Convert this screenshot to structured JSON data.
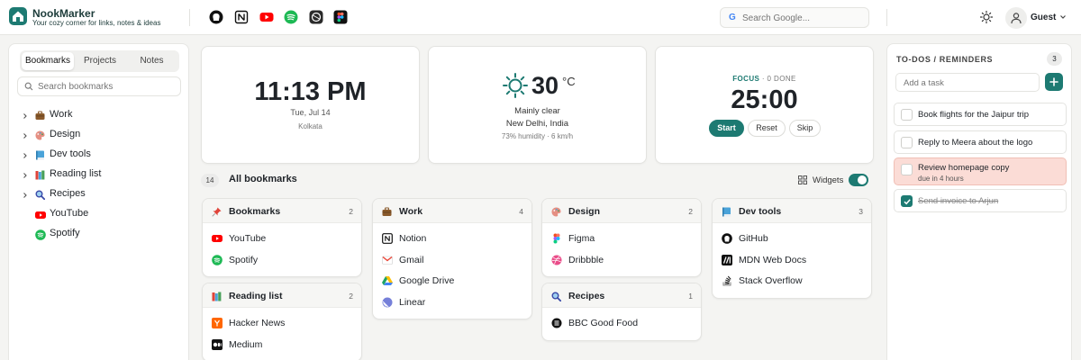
{
  "brand": {
    "name": "NookMarker",
    "tagline": "Your cozy corner for links, notes & ideas"
  },
  "quick_links": [
    {
      "name": "github-icon",
      "color": "#111111"
    },
    {
      "name": "notion-icon",
      "color": "#111111"
    },
    {
      "name": "youtube-icon",
      "color": "#ff0000"
    },
    {
      "name": "spotify-icon",
      "color": "#1db954"
    },
    {
      "name": "apple-icon",
      "color": "#222222"
    },
    {
      "name": "figma-icon",
      "color": "#111111"
    }
  ],
  "search": {
    "placeholder": "Search Google..."
  },
  "user": {
    "name": "Guest"
  },
  "sidebar": {
    "tabs": [
      {
        "label": "Bookmarks"
      },
      {
        "label": "Projects"
      },
      {
        "label": "Notes"
      }
    ],
    "search_placeholder": "Search bookmarks",
    "items": [
      {
        "label": "Work",
        "icon": "briefcase-icon",
        "color": "#8a5a2b",
        "folder": true
      },
      {
        "label": "Design",
        "icon": "palette-icon",
        "color": "#e58f82",
        "folder": true
      },
      {
        "label": "Dev tools",
        "icon": "book-icon",
        "color": "#4aa3d9",
        "folder": true
      },
      {
        "label": "Reading list",
        "icon": "books-icon",
        "color": "#48a05a",
        "folder": true
      },
      {
        "label": "Recipes",
        "icon": "magnifier-icon",
        "color": "#3a4aa8",
        "folder": true
      },
      {
        "label": "YouTube",
        "icon": "youtube-icon",
        "color": "#ff0000",
        "folder": false
      },
      {
        "label": "Spotify",
        "icon": "spotify-icon",
        "color": "#1db954",
        "folder": false
      }
    ]
  },
  "clock": {
    "time": "11:13 PM",
    "date": "Tue, Jul 14",
    "city": "Kolkata"
  },
  "weather": {
    "temp": "30",
    "unit": "°C",
    "condition": "Mainly clear",
    "location": "New Delhi, India",
    "meta": "73% humidity · 6 km/h"
  },
  "focus": {
    "label": "FOCUS",
    "status": "· 0 DONE",
    "time": "25:00",
    "start": "Start",
    "reset": "Reset",
    "skip": "Skip"
  },
  "bookmarks": {
    "count": "14",
    "title": "All bookmarks",
    "widgets_label": "Widgets",
    "widgets_on": true
  },
  "groups": [
    {
      "title": "Bookmarks",
      "count": "2",
      "icon": "pin-icon",
      "color": "#e0443a",
      "links": [
        {
          "label": "YouTube",
          "icon": "youtube-icon",
          "color": "#ff0000"
        },
        {
          "label": "Spotify",
          "icon": "spotify-icon",
          "color": "#1db954"
        }
      ]
    },
    {
      "title": "Reading list",
      "count": "2",
      "icon": "books-icon",
      "color": "#48a05a",
      "links": [
        {
          "label": "Hacker News",
          "icon": "hackernews-icon",
          "color": "#ff6600"
        },
        {
          "label": "Medium",
          "icon": "medium-icon",
          "color": "#111111"
        }
      ]
    },
    {
      "title": "Work",
      "count": "4",
      "icon": "briefcase-icon",
      "color": "#8a5a2b",
      "links": [
        {
          "label": "Notion",
          "icon": "notion-icon",
          "color": "#111111"
        },
        {
          "label": "Gmail",
          "icon": "gmail-icon",
          "color": "#ea4335"
        },
        {
          "label": "Google Drive",
          "icon": "drive-icon",
          "color": "#1fa463"
        },
        {
          "label": "Linear",
          "icon": "linear-icon",
          "color": "#5e6ad2"
        }
      ]
    },
    {
      "title": "Design",
      "count": "2",
      "icon": "palette-icon",
      "color": "#e58f82",
      "links": [
        {
          "label": "Figma",
          "icon": "figma-icon",
          "color": "#f24e1e"
        },
        {
          "label": "Dribbble",
          "icon": "dribbble-icon",
          "color": "#ea4c89"
        }
      ]
    },
    {
      "title": "Recipes",
      "count": "1",
      "icon": "magnifier-icon",
      "color": "#3a4aa8",
      "links": [
        {
          "label": "BBC Good Food",
          "icon": "bbc-icon",
          "color": "#111111"
        }
      ]
    },
    {
      "title": "Dev tools",
      "count": "3",
      "icon": "book-icon",
      "color": "#4aa3d9",
      "links": [
        {
          "label": "GitHub",
          "icon": "github-icon",
          "color": "#111111"
        },
        {
          "label": "MDN Web Docs",
          "icon": "mdn-icon",
          "color": "#111111"
        },
        {
          "label": "Stack Overflow",
          "icon": "stackoverflow-icon",
          "color": "#222222"
        }
      ]
    }
  ],
  "todos": {
    "title": "TO-DOS / REMINDERS",
    "count": "3",
    "placeholder": "Add a task",
    "items": [
      {
        "text": "Book flights for the Jaipur trip",
        "done": false
      },
      {
        "text": "Reply to Meera about the logo",
        "done": false
      },
      {
        "text": "Review homepage copy",
        "due": "due in 4 hours",
        "done": false,
        "alert": true
      },
      {
        "text": "Send invoice to Arjun",
        "done": true
      }
    ]
  },
  "colors": {
    "accent": "#1d7a72",
    "alert": "#fbdcd6"
  }
}
